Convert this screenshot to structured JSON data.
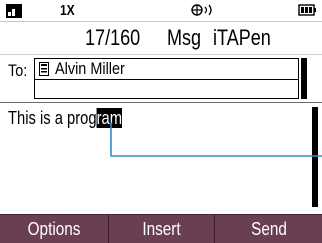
{
  "status_bar": {
    "network": "1X",
    "icons": [
      "signal-strength-icon",
      "roaming-icon",
      "battery-icon"
    ]
  },
  "title_bar": {
    "char_count": "17/160",
    "screen_title": "Msg",
    "input_mode": "iTAPen"
  },
  "recipient": {
    "to_label": "To:",
    "contact_icon": "contact-card-icon",
    "contact_name": "Alvin Miller"
  },
  "message": {
    "text_before": "This is a prog",
    "text_selected": "ram"
  },
  "softkeys": {
    "left": "Options",
    "center": "Insert",
    "right": "Send"
  },
  "colors": {
    "softkey_background": "#6b3f52",
    "callout_line": "#2f8fcf"
  }
}
